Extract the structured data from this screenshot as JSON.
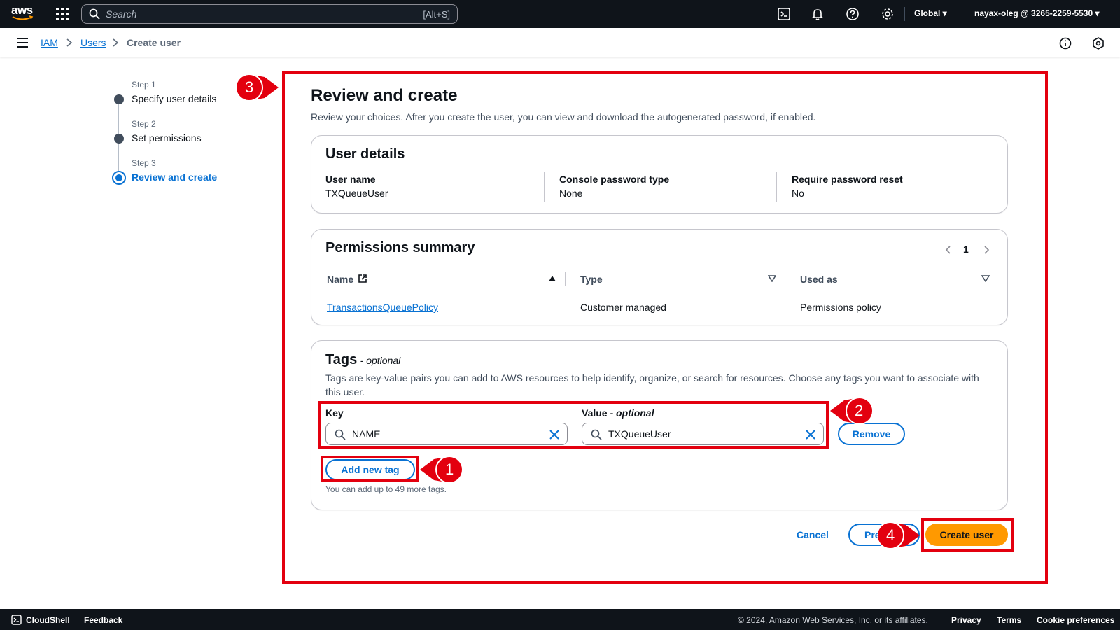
{
  "topnav": {
    "logo": "aws",
    "search_placeholder": "Search",
    "search_shortcut": "[Alt+S]",
    "region": "Global",
    "account": "nayax-oleg @ 3265-2259-5530",
    "icons": [
      "cloudshell-icon",
      "bell-icon",
      "help-icon",
      "settings-icon"
    ]
  },
  "breadcrumb": {
    "items": [
      "IAM",
      "Users",
      "Create user"
    ]
  },
  "steps": [
    {
      "num": "Step 1",
      "label": "Specify user details"
    },
    {
      "num": "Step 2",
      "label": "Set permissions"
    },
    {
      "num": "Step 3",
      "label": "Review and create"
    }
  ],
  "page": {
    "title": "Review and create",
    "subtitle": "Review your choices. After you create the user, you can view and download the autogenerated password, if enabled."
  },
  "user_details": {
    "title": "User details",
    "fields": [
      {
        "label": "User name",
        "value": "TXQueueUser"
      },
      {
        "label": "Console password type",
        "value": "None"
      },
      {
        "label": "Require password reset",
        "value": "No"
      }
    ]
  },
  "permissions": {
    "title": "Permissions summary",
    "page": "1",
    "columns": [
      "Name",
      "Type",
      "Used as"
    ],
    "rows": [
      {
        "name": "TransactionsQueuePolicy",
        "type": "Customer managed",
        "used_as": "Permissions policy"
      }
    ]
  },
  "tags": {
    "title": "Tags",
    "title_suffix": "- optional",
    "description": "Tags are key-value pairs you can add to AWS resources to help identify, organize, or search for resources. Choose any tags you want to associate with this user.",
    "key_label": "Key",
    "value_label": "Value",
    "value_suffix": "- optional",
    "key_value": "NAME",
    "value_value": "TXQueueUser",
    "remove_label": "Remove",
    "add_label": "Add new tag",
    "hint": "You can add up to 49 more tags."
  },
  "actions": {
    "cancel": "Cancel",
    "previous": "Pre",
    "create": "Create user"
  },
  "annotations": [
    "1",
    "2",
    "3",
    "4"
  ],
  "footer": {
    "cloudshell": "CloudShell",
    "feedback": "Feedback",
    "copyright": "© 2024, Amazon Web Services, Inc. or its affiliates.",
    "privacy": "Privacy",
    "terms": "Terms",
    "cookie": "Cookie preferences"
  },
  "colors": {
    "link": "#0972d3",
    "primary": "#ff9900",
    "annotation": "#e3000f",
    "nav_bg": "#0f141a"
  }
}
